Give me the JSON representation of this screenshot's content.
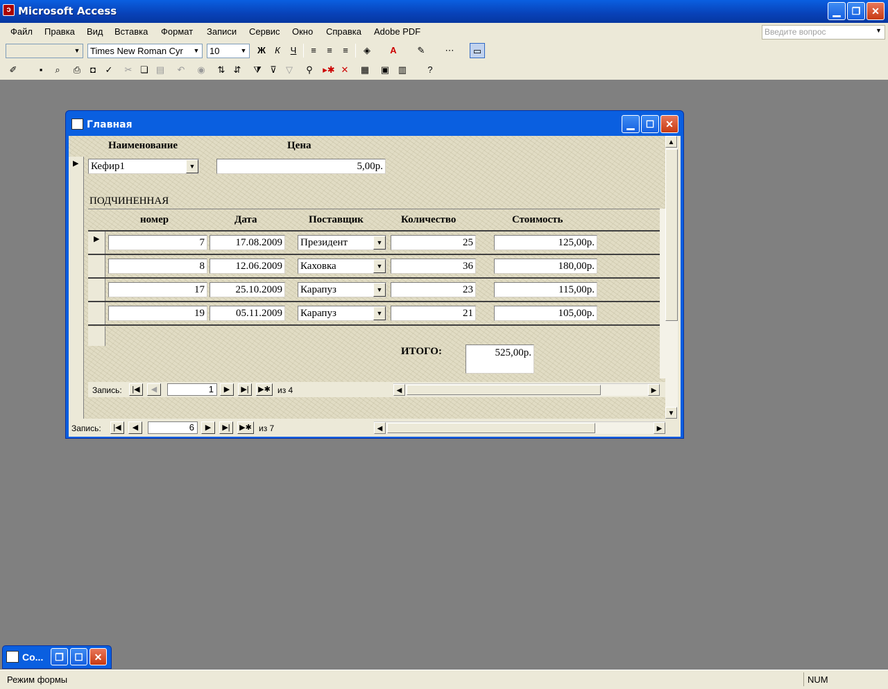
{
  "app": {
    "title": "Microsoft Access"
  },
  "menu": {
    "items": [
      "Файл",
      "Правка",
      "Вид",
      "Вставка",
      "Формат",
      "Записи",
      "Сервис",
      "Окно",
      "Справка",
      "Adobe PDF"
    ],
    "help_placeholder": "Введите вопрос"
  },
  "format_toolbar": {
    "object_combo": "",
    "font_name": "Times New Roman Cyr",
    "font_size": "10"
  },
  "form": {
    "title": "Главная",
    "header": {
      "name_label": "Наименование",
      "price_label": "Цена"
    },
    "record": {
      "name": "Кефир1",
      "price": "5,00р."
    },
    "subform_label": "ПОДЧИНЕННАЯ",
    "subform": {
      "columns": [
        "номер",
        "Дата",
        "Поставщик",
        "Количество",
        "Стоимость"
      ],
      "rows": [
        {
          "num": "7",
          "date": "17.08.2009",
          "supplier": "Президент",
          "qty": "25",
          "cost": "125,00р."
        },
        {
          "num": "8",
          "date": "12.06.2009",
          "supplier": "Каховка",
          "qty": "36",
          "cost": "180,00р."
        },
        {
          "num": "17",
          "date": "25.10.2009",
          "supplier": "Карапуз",
          "qty": "23",
          "cost": "115,00р."
        },
        {
          "num": "19",
          "date": "05.11.2009",
          "supplier": "Карапуз",
          "qty": "21",
          "cost": "105,00р."
        }
      ],
      "total_label": "ИТОГО:",
      "total_value": "525,00р.",
      "nav": {
        "label": "Запись:",
        "current": "1",
        "of_text": "из  4"
      }
    },
    "nav": {
      "label": "Запись:",
      "current": "6",
      "of_text": "из  7"
    }
  },
  "taskbar_item": {
    "label": "Со..."
  },
  "status": {
    "mode": "Режим формы",
    "num": "NUM"
  }
}
